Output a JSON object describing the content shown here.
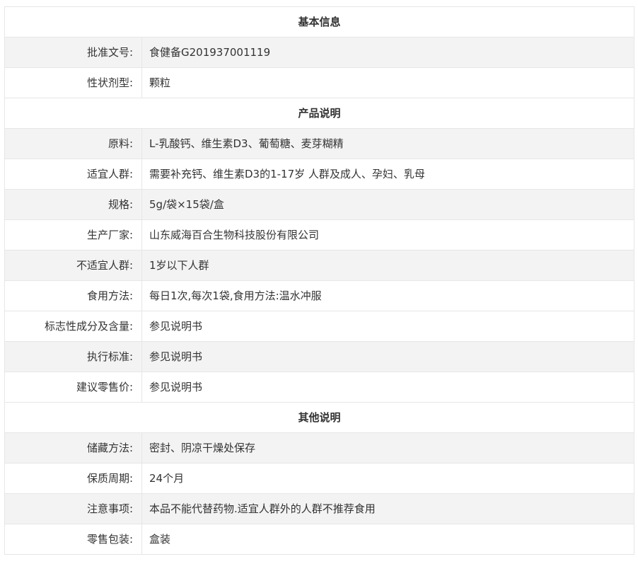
{
  "sections": [
    {
      "title": "基本信息",
      "rows": [
        {
          "label": "批准文号:",
          "value": "食健备G201937001119"
        },
        {
          "label": "性状剂型:",
          "value": "颗粒"
        }
      ]
    },
    {
      "title": "产品说明",
      "rows": [
        {
          "label": "原料:",
          "value": "L-乳酸钙、维生素D3、葡萄糖、麦芽糊精"
        },
        {
          "label": "适宜人群:",
          "value": "需要补充钙、维生素D3的1-17岁 人群及成人、孕妇、乳母"
        },
        {
          "label": "规格:",
          "value": "5g/袋×15袋/盒"
        },
        {
          "label": "生产厂家:",
          "value": "山东威海百合生物科技股份有限公司"
        },
        {
          "label": "不适宜人群:",
          "value": "1岁以下人群"
        },
        {
          "label": "食用方法:",
          "value": "每日1次,每次1袋,食用方法:温水冲服"
        },
        {
          "label": "标志性成分及含量:",
          "value": "参见说明书"
        },
        {
          "label": "执行标准:",
          "value": "参见说明书"
        },
        {
          "label": "建议零售价:",
          "value": "参见说明书"
        }
      ]
    },
    {
      "title": "其他说明",
      "rows": [
        {
          "label": "储藏方法:",
          "value": "密封、阴凉干燥处保存"
        },
        {
          "label": "保质周期:",
          "value": "24个月"
        },
        {
          "label": "注意事项:",
          "value": "本品不能代替药物.适宜人群外的人群不推荐食用"
        },
        {
          "label": "零售包装:",
          "value": "盒装"
        }
      ]
    }
  ]
}
